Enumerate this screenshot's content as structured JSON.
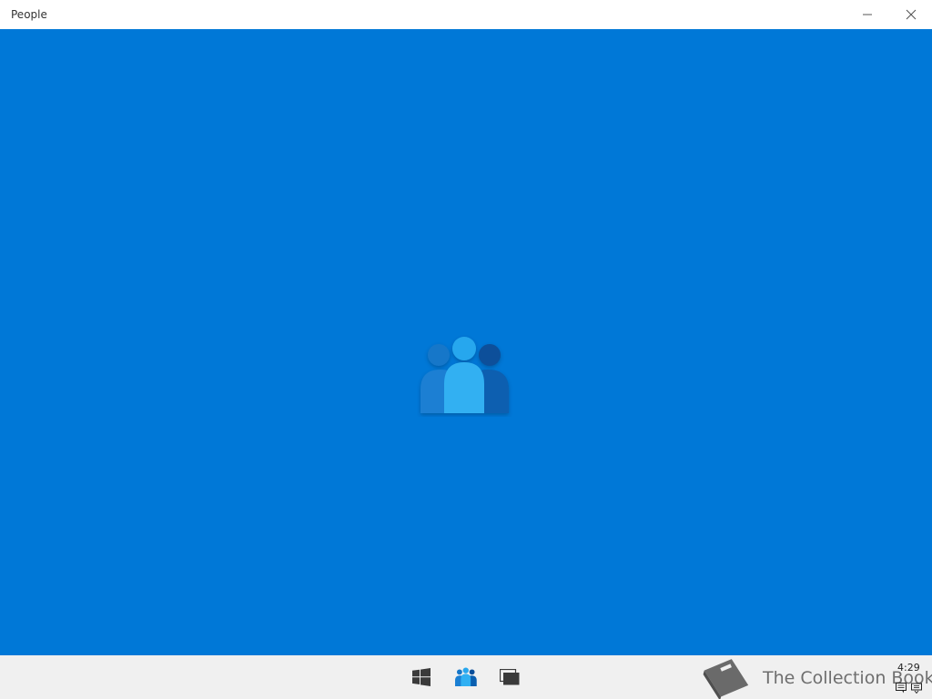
{
  "window": {
    "title": "People",
    "buttons": {
      "minimize_icon": "minimize-icon",
      "close_icon": "close-icon"
    }
  },
  "splash": {
    "background_color": "#0078d7",
    "logo_icon": "people-icon"
  },
  "taskbar": {
    "buttons": [
      {
        "name": "start-button",
        "icon": "windows-logo-icon"
      },
      {
        "name": "people-app-button",
        "icon": "people-icon"
      },
      {
        "name": "task-view-button",
        "icon": "task-view-icon"
      }
    ],
    "clock": "4:29",
    "tray_icons": [
      "notification-icon",
      "keyboard-icon"
    ]
  },
  "watermark": {
    "text": "The Collection Book",
    "icon": "book-icon"
  }
}
